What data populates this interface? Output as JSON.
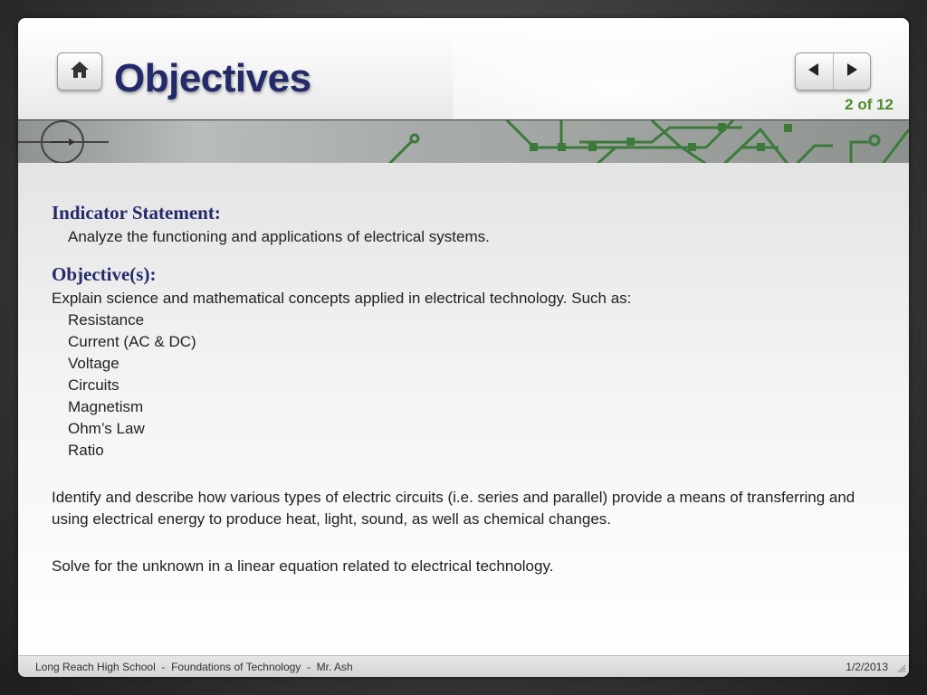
{
  "slide": {
    "title": "Objectives",
    "page_indicator": "2 of 12",
    "buttons": {
      "home_icon": "home-icon",
      "prev_icon": "arrow-left-icon",
      "next_icon": "arrow-right-icon"
    }
  },
  "content": {
    "indicator_heading": "Indicator Statement:",
    "indicator_text": "Analyze the functioning and applications of electrical systems.",
    "objectives_heading": "Objective(s):",
    "objective_intro": "Explain science and mathematical concepts applied in electrical technology. Such as:",
    "concepts": [
      "Resistance",
      "Current (AC & DC)",
      "Voltage",
      "Circuits",
      "Magnetism",
      "Ohm’s Law",
      "Ratio"
    ],
    "paragraph_1": "Identify and describe how various types of electric circuits (i.e. series and parallel) provide a means of transferring  and using electrical energy to produce heat, light, sound, as well as chemical changes.",
    "paragraph_2": "Solve for the unknown in a linear equation related to electrical technology."
  },
  "footer": {
    "left": "Long Reach High School  -  Foundations of Technology  -  Mr. Ash",
    "right": "1/2/2013"
  },
  "colors": {
    "title": "#232a6a",
    "page_indicator": "#4e8a2c",
    "heading": "#232a6a",
    "circuit_green": "#3c7a3a"
  }
}
